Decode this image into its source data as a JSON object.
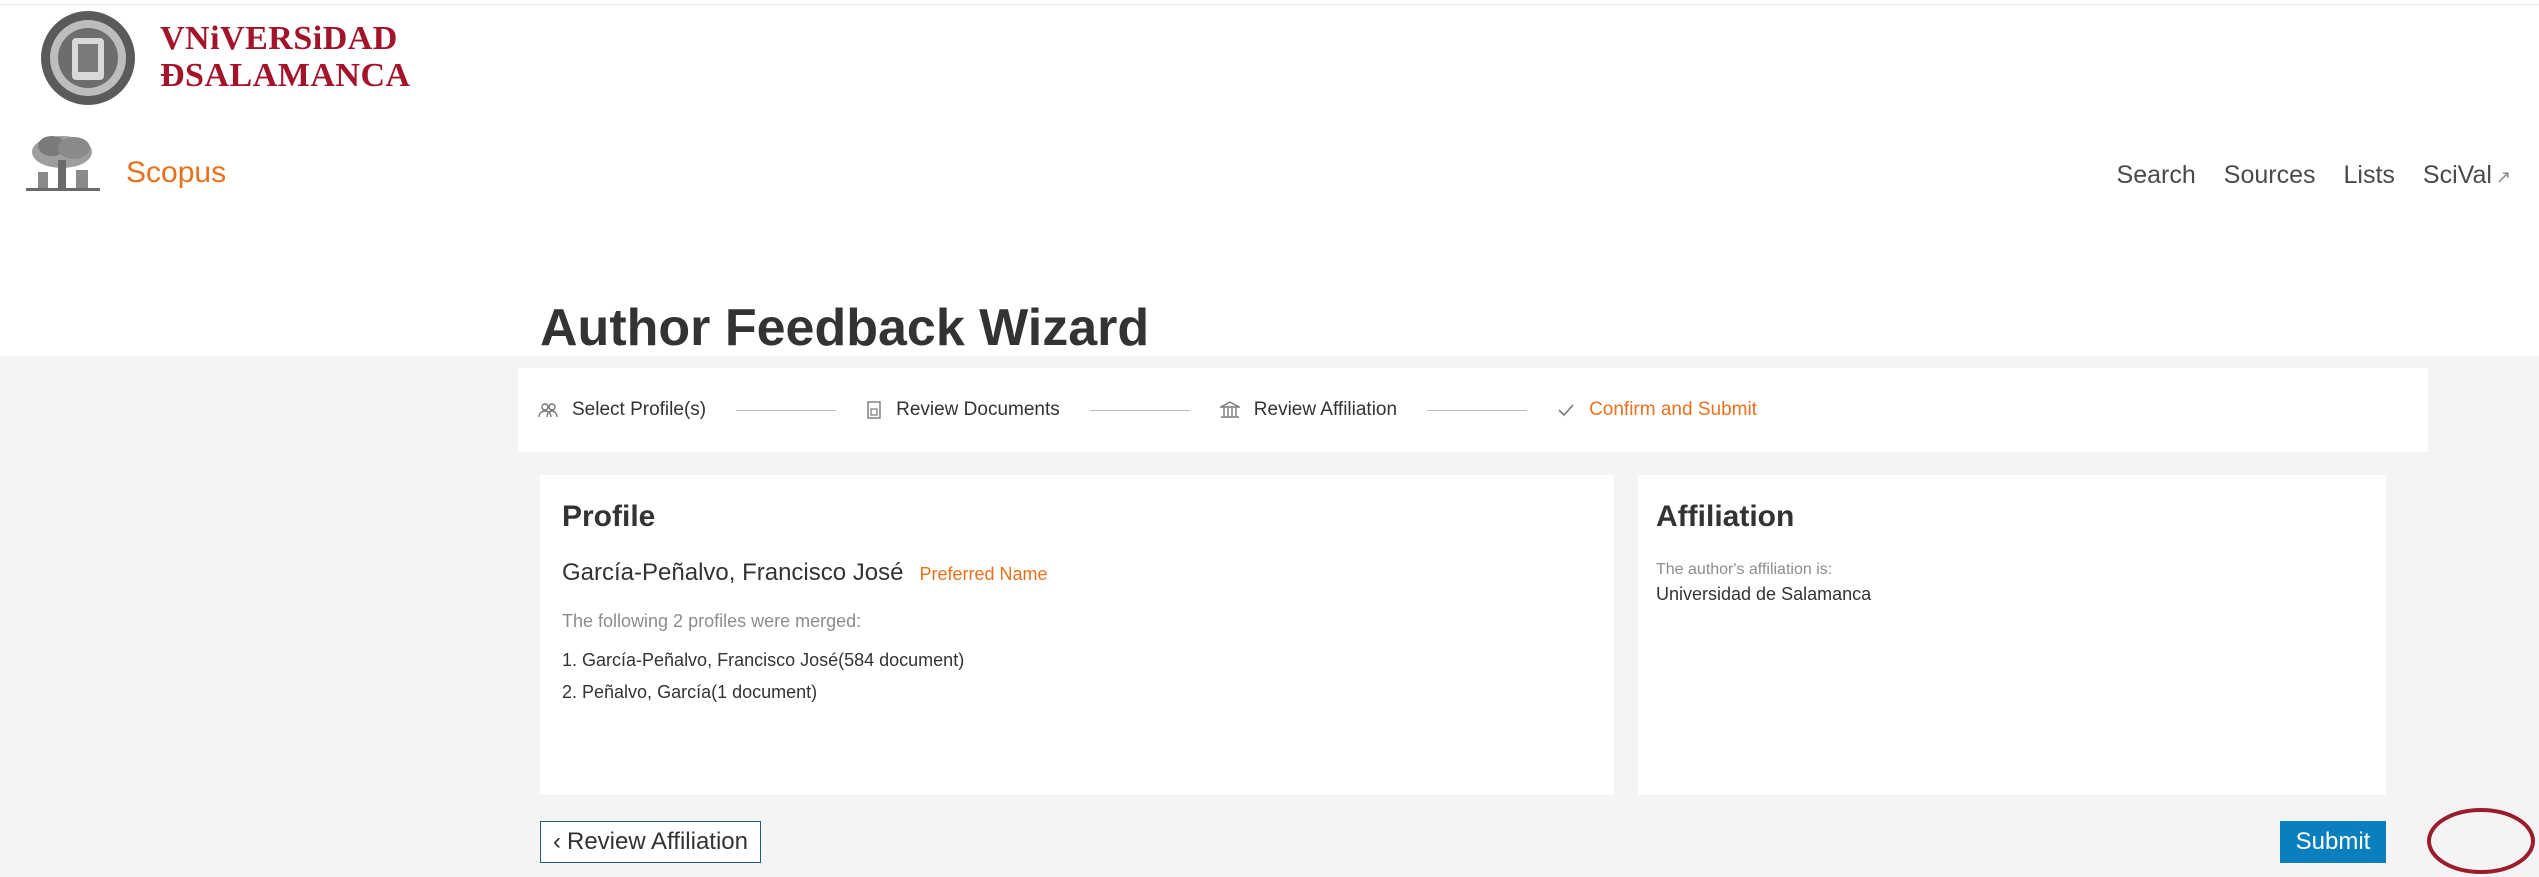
{
  "university": {
    "line1": "VNiVERSiDAD",
    "line2": "ÐSALAMANCA"
  },
  "brand": {
    "name": "Scopus"
  },
  "nav": {
    "search": "Search",
    "sources": "Sources",
    "lists": "Lists",
    "scival": "SciVal",
    "scival_icon": "external-link-icon"
  },
  "page": {
    "title": "Author Feedback Wizard"
  },
  "steps": [
    {
      "label": "Select Profile(s)",
      "icon": "people-icon"
    },
    {
      "label": "Review Documents",
      "icon": "document-icon"
    },
    {
      "label": "Review Affiliation",
      "icon": "building-icon"
    },
    {
      "label": "Confirm and Submit",
      "icon": "check-icon",
      "active": true
    }
  ],
  "profile": {
    "title": "Profile",
    "name": "García-Peñalvo, Francisco José",
    "preferred_label": "Preferred Name",
    "merged_note": "The following 2 profiles were merged:",
    "merged": [
      "1. García-Peñalvo, Francisco José(584 document)",
      "2. Peñalvo, García(1 document)"
    ]
  },
  "affiliation": {
    "title": "Affiliation",
    "label": "The author's affiliation is:",
    "value": "Universidad de Salamanca"
  },
  "actions": {
    "back_label": "Review Affiliation",
    "submit_label": "Submit"
  },
  "colors": {
    "accent": "#e9711c",
    "brand_red": "#a3132a",
    "submit": "#0b7fbd",
    "highlight": "#9b1c2e"
  }
}
